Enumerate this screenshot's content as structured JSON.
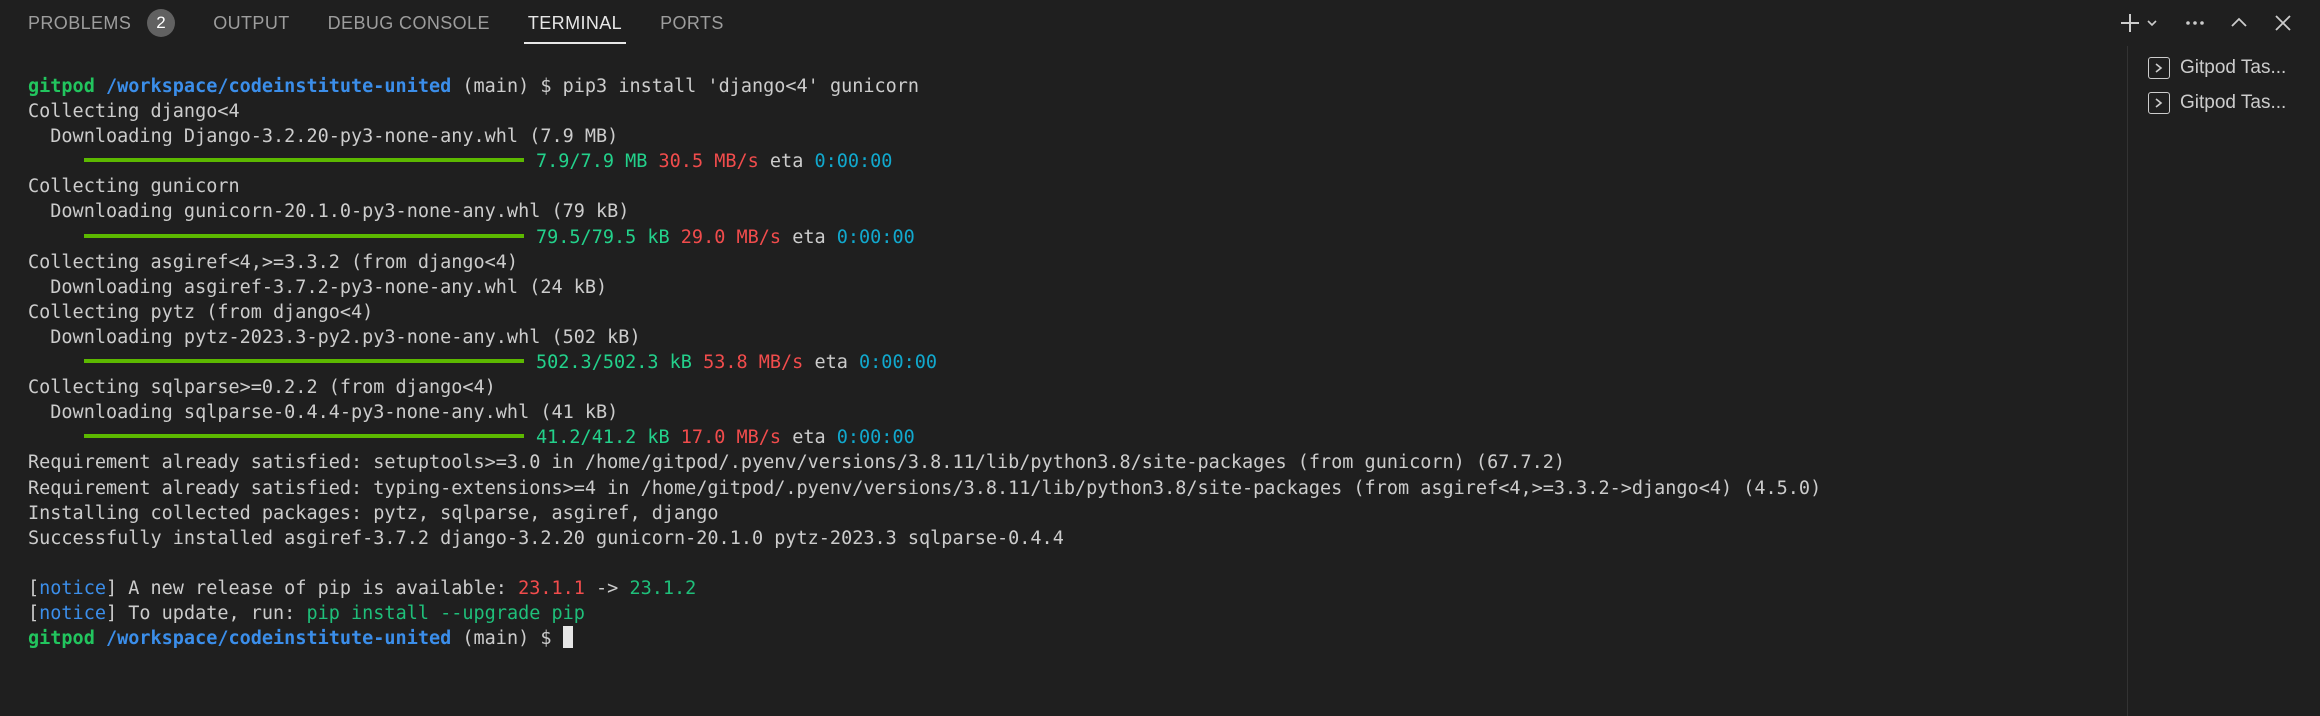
{
  "tabs": {
    "problems": "PROBLEMS",
    "problems_count": "2",
    "output": "OUTPUT",
    "debug_console": "DEBUG CONSOLE",
    "terminal": "TERMINAL",
    "ports": "PORTS"
  },
  "actions": {
    "icons": [
      "plus-icon",
      "chevron-down-icon",
      "more-icon",
      "chevron-up-icon",
      "close-icon"
    ]
  },
  "prompt": {
    "user": "gitpod",
    "path": "/workspace/codeinstitute-united",
    "branch": " (main) $ "
  },
  "terminal": {
    "command": "pip3 install 'django<4' gunicorn",
    "l2": "Collecting django<4",
    "l3": "  Downloading Django-3.2.20-py3-none-any.whl (7.9 MB)",
    "p1": {
      "size": "7.9/7.9 MB",
      "speed": "30.5 MB/s",
      "eta_label": "eta",
      "eta": "0:00:00",
      "progress": 1.0
    },
    "l5": "Collecting gunicorn",
    "l6": "  Downloading gunicorn-20.1.0-py3-none-any.whl (79 kB)",
    "p2": {
      "size": "79.5/79.5 kB",
      "speed": "29.0 MB/s",
      "eta_label": "eta",
      "eta": "0:00:00",
      "progress": 1.0
    },
    "l8": "Collecting asgiref<4,>=3.3.2 (from django<4)",
    "l9": "  Downloading asgiref-3.7.2-py3-none-any.whl (24 kB)",
    "l10": "Collecting pytz (from django<4)",
    "l11": "  Downloading pytz-2023.3-py2.py3-none-any.whl (502 kB)",
    "p3": {
      "size": "502.3/502.3 kB",
      "speed": "53.8 MB/s",
      "eta_label": "eta",
      "eta": "0:00:00",
      "progress": 1.0
    },
    "l13": "Collecting sqlparse>=0.2.2 (from django<4)",
    "l14": "  Downloading sqlparse-0.4.4-py3-none-any.whl (41 kB)",
    "p4": {
      "size": "41.2/41.2 kB",
      "speed": "17.0 MB/s",
      "eta_label": "eta",
      "eta": "0:00:00",
      "progress": 1.0
    },
    "l16": "Requirement already satisfied: setuptools>=3.0 in /home/gitpod/.pyenv/versions/3.8.11/lib/python3.8/site-packages (from gunicorn) (67.7.2)",
    "l17": "Requirement already satisfied: typing-extensions>=4 in /home/gitpod/.pyenv/versions/3.8.11/lib/python3.8/site-packages (from asgiref<4,>=3.3.2->django<4) (4.5.0)",
    "l18": "Installing collected packages: pytz, sqlparse, asgiref, django",
    "l19": "Successfully installed asgiref-3.7.2 django-3.2.20 gunicorn-20.1.0 pytz-2023.3 sqlparse-0.4.4",
    "notice1": {
      "open": "[",
      "word": "notice",
      "close": "] ",
      "text": "A new release of pip is available: ",
      "old": "23.1.1",
      "arrow": " -> ",
      "new": "23.1.2"
    },
    "notice2": {
      "open": "[",
      "word": "notice",
      "close": "] ",
      "text": "To update, run: ",
      "cmd": "pip install --upgrade pip"
    }
  },
  "tasks": [
    {
      "label": "Gitpod Tas..."
    },
    {
      "label": "Gitpod Tas..."
    }
  ],
  "colors": {
    "background": "#1f1f1f",
    "prompt_user": "#22c55e",
    "prompt_path": "#3b8eea",
    "progress_bar": "#5cb800",
    "size_text": "#23d18b",
    "speed_text": "#f14c4c",
    "eta_text": "#11a8cd"
  }
}
